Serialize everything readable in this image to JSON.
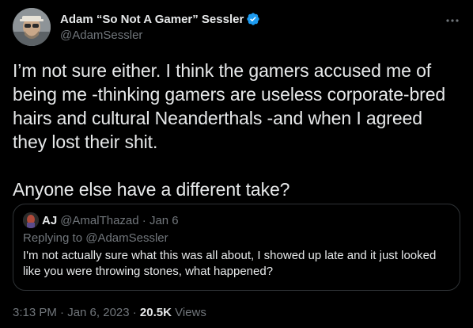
{
  "author": {
    "display_name": "Adam “So Not A Gamer” Sessler",
    "handle": "@AdamSessler",
    "verified": true
  },
  "tweet": {
    "lines": [
      "I’m not sure either. I think the gamers accused me of",
      "being me -thinking gamers are useless corporate-bred",
      "hairs and cultural Neanderthals -and when I agreed",
      "they lost their shit."
    ],
    "closing_line": "Anyone else have a different take?"
  },
  "quoted_tweet": {
    "name": "AJ",
    "handle_date": "@AmalThazad · Jan 6",
    "replying_prefix": "Replying to",
    "replying_to": "@AdamSessler",
    "lines": [
      "I'm not actually sure what this was all about, I showed up late and it just looked",
      "like you were throwing stones, what happened?"
    ]
  },
  "meta": {
    "timestamp": "3:13 PM · Jan 6, 2023 · ",
    "views_count": "20.5K",
    "views_label": " Views"
  },
  "colors": {
    "background": "#000000",
    "text": "#e7e9ea",
    "muted": "#71767b",
    "verified_blue": "#1d9bf0",
    "border": "#2f3336"
  },
  "icons": {
    "verified": "verified-badge-icon",
    "more": "more-options-icon"
  }
}
